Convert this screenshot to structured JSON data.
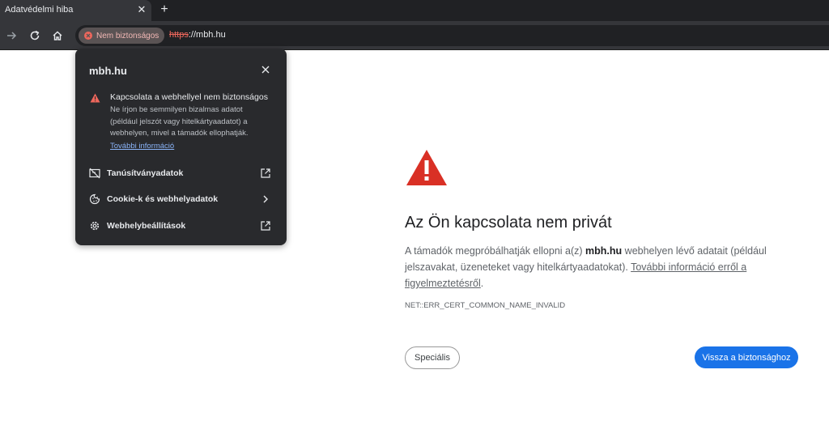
{
  "tab": {
    "title": "Adatvédelmi hiba",
    "close_glyph": "✕",
    "new_tab_glyph": "+"
  },
  "toolbar": {
    "icons": [
      "forward-icon",
      "reload-icon",
      "home-icon"
    ],
    "security_chip": "Nem biztonságos",
    "url_scheme": "https",
    "url_rest": "://mbh.hu"
  },
  "popup": {
    "domain": "mbh.hu",
    "warning_title": "Kapcsolata a webhellyel nem biztonságos",
    "warning_body": "Ne írjon be semmilyen bizalmas adatot (például jelszót vagy hitelkártyaadatot) a webhelyen, mivel a támadók ellophatják.",
    "learn_more": "További információ",
    "rows": [
      {
        "label": "Tanúsítványadatok",
        "icon": "certificate-icon",
        "trail": "external-link-icon"
      },
      {
        "label": "Cookie-k és webhelyadatok",
        "icon": "cookie-icon",
        "trail": "chevron-right-icon"
      },
      {
        "label": "Webhelybeállítások",
        "icon": "settings-icon",
        "trail": "external-link-icon"
      }
    ]
  },
  "page": {
    "heading": "Az Ön kapcsolata nem privát",
    "desc_part1": "A támadók megpróbálhatják ellopni a(z) ",
    "desc_domain": "mbh.hu",
    "desc_part2": " webhelyen lévő adatait (például jelszavakat, üzeneteket vagy hitelkártyaadatokat). ",
    "desc_link": "További információ erről a figyelmeztetésről",
    "desc_end": ".",
    "error_code": "NET::ERR_CERT_COMMON_NAME_INVALID",
    "advanced_button": "Speciális",
    "back_button": "Vissza a biztonsághoz"
  },
  "colors": {
    "accent": "#1a73e8",
    "danger": "#d93025",
    "chip_text": "#f2b8b5"
  }
}
